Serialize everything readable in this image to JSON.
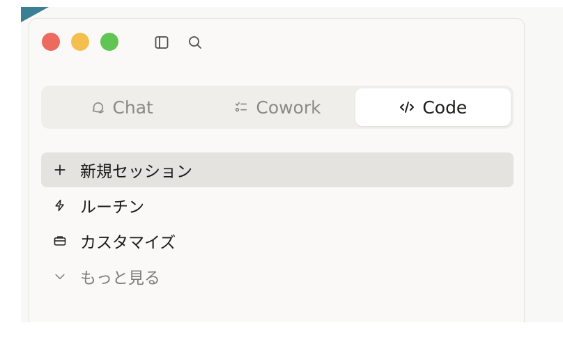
{
  "titlebar": {
    "icons": [
      "sidebar-toggle-icon",
      "search-icon"
    ]
  },
  "tabs": [
    {
      "label": "Chat",
      "icon": "chat-bubble-icon",
      "active": false
    },
    {
      "label": "Cowork",
      "icon": "checklist-icon",
      "active": false
    },
    {
      "label": "Code",
      "icon": "code-icon",
      "active": true
    }
  ],
  "menu": {
    "items": [
      {
        "label": "新規セッション",
        "icon": "plus-icon",
        "selected": true
      },
      {
        "label": "ルーチン",
        "icon": "lightning-icon",
        "selected": false
      },
      {
        "label": "カスタマイズ",
        "icon": "briefcase-icon",
        "selected": false
      },
      {
        "label": "もっと見る",
        "icon": "chevron-down-icon",
        "selected": false
      }
    ]
  },
  "colors": {
    "close": "#ec6a5e",
    "minimize": "#f4bf4f",
    "zoom": "#61c554",
    "backdrop_accent": "#3b7f93"
  }
}
